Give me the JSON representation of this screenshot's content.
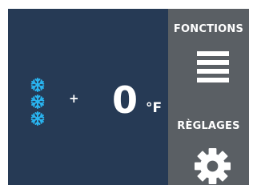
{
  "display": {
    "mode_icon": "snowflake-icon",
    "mode_icon_count": 3,
    "sign": "+",
    "temperature": "0",
    "unit": "°F",
    "snow_color": "#29b4f0"
  },
  "sidebar": {
    "functions_label": "FONCTIONS",
    "functions_icon": "menu-icon",
    "settings_label": "RÈGLAGES",
    "settings_icon": "gear-icon"
  },
  "colors": {
    "screen_background": "#263a55",
    "sidebar_background": "#5a5f64",
    "text": "#ffffff"
  }
}
